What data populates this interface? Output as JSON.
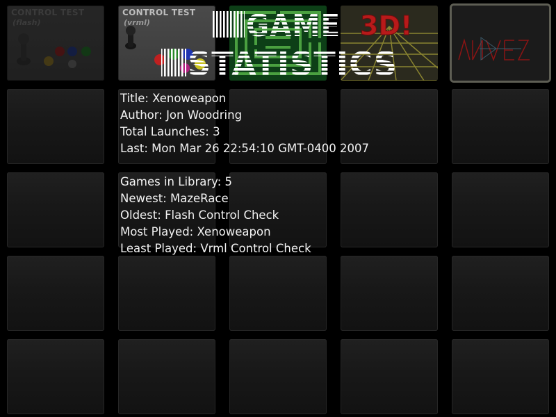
{
  "heading": {
    "line1": "GAME",
    "line2": "STATISTICS"
  },
  "thumbnails": [
    {
      "title": "CONTROL TEST",
      "subtitle": "(flash)",
      "state": "dimmed"
    },
    {
      "title": "CONTROL TEST",
      "subtitle": "(vrml)",
      "state": "normal"
    },
    {
      "title": "",
      "subtitle": "",
      "state": "normal",
      "icon": "maze-icon"
    },
    {
      "title": "3D!",
      "subtitle": "",
      "state": "normal"
    },
    {
      "title": "",
      "subtitle": "",
      "state": "selected",
      "icon": "xenoweapon-icon"
    }
  ],
  "selected_game": {
    "title_line": "Title: Xenoweapon",
    "author_line": "Author: Jon Woodring",
    "launches_line": "Total Launches: 3",
    "last_line": "Last: Mon Mar 26 22:54:10 GMT-0400 2007"
  },
  "library": {
    "count_line": "Games in Library: 5",
    "newest_line": "Newest: MazeRace",
    "oldest_line": "Oldest: Flash Control Check",
    "most_played_line": "Most Played: Xenoweapon",
    "least_played_line": "Least Played: Vrml Control Check"
  },
  "colors": {
    "background": "#000000",
    "tile": "#1a1a1a",
    "text": "#f2f2f2",
    "maze_green": "#0d3f17",
    "accent_red": "#c01818"
  }
}
